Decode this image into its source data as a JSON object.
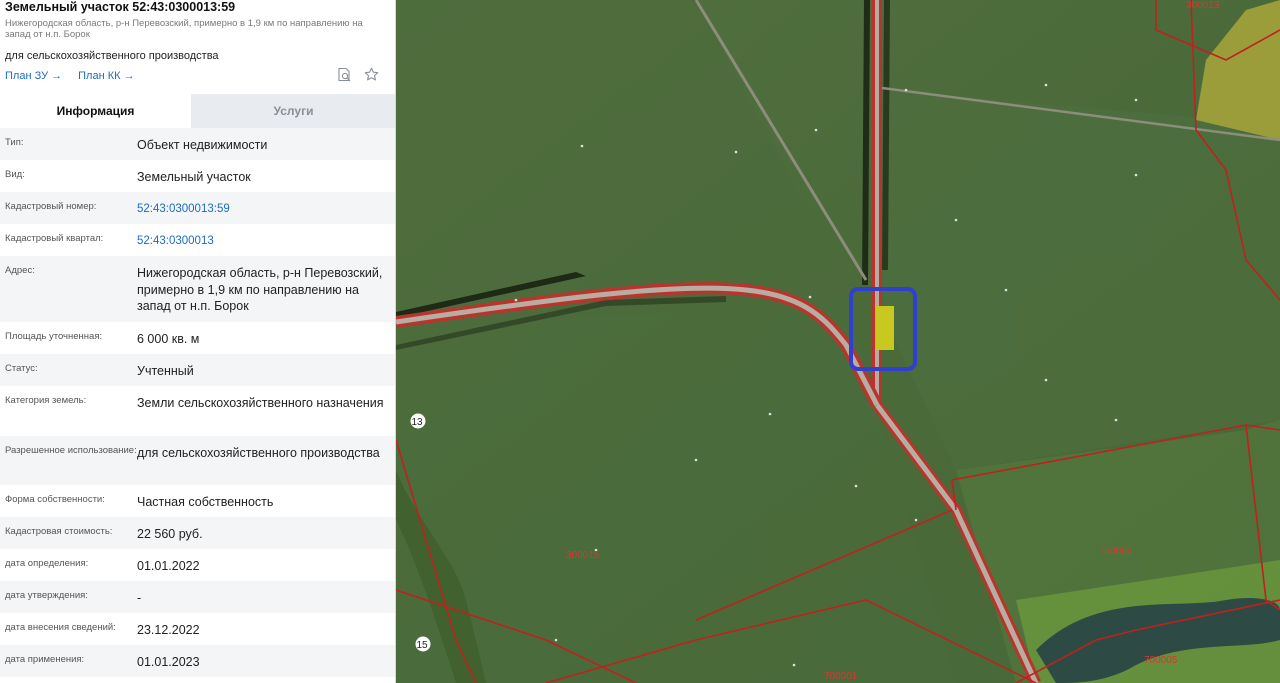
{
  "panel": {
    "title": "Земельный участок 52:43:0300013:59",
    "address_line": "Нижегородская область, р-н Перевозский, примерно в 1,9 км по направлению на запад от н.п. Борок",
    "use": "для сельскохозяйственного производства",
    "links": {
      "plan_zu": "План ЗУ →",
      "plan_kk": "План КК →"
    },
    "icons": {
      "search": "search-document-icon",
      "favorite": "star-icon"
    },
    "tabs": {
      "info": "Информация",
      "services": "Услуги"
    },
    "rows": [
      {
        "label": "Тип:",
        "value": "Объект недвижимости"
      },
      {
        "label": "Вид:",
        "value": "Земельный участок"
      },
      {
        "label": "Кадастровый номер:",
        "value": "52:43:0300013:59"
      },
      {
        "label": "Кадастровый квартал:",
        "value": "52:43:0300013"
      },
      {
        "label": "Адрес:",
        "value": "Нижегородская область, р-н Перевозский, примерно в 1,9 км по направлению на запад от н.п. Борок"
      },
      {
        "label": "Площадь уточненная:",
        "value": "6 000 кв. м"
      },
      {
        "label": "Статус:",
        "value": "Учтенный"
      },
      {
        "label": "Категория земель:",
        "value": "Земли сельскохозяйственного назначения"
      },
      {
        "label": "Разрешенное использование:",
        "value": "для сельскохозяйственного производства"
      },
      {
        "label": "Форма собственности:",
        "value": "Частная собственность"
      },
      {
        "label": "Кадастровая стоимость:",
        "value": "22 560 руб."
      },
      {
        "label": "дата определения:",
        "value": "01.01.2022"
      },
      {
        "label": "дата утверждения:",
        "value": "-"
      },
      {
        "label": "дата внесения сведений:",
        "value": "23.12.2022"
      },
      {
        "label": "дата применения:",
        "value": "01.01.2023"
      }
    ]
  },
  "map": {
    "labels": {
      "q300013": "300013",
      "q300015": "300015",
      "q700002": "700002",
      "q700001": "700001",
      "q700005": "700005",
      "n13": "13",
      "n15": "15"
    },
    "colors": {
      "field": "#4a6a3a",
      "boundary": "#c0211f",
      "highlight": "#2f3fcf",
      "parcel": "#c9c820"
    }
  }
}
